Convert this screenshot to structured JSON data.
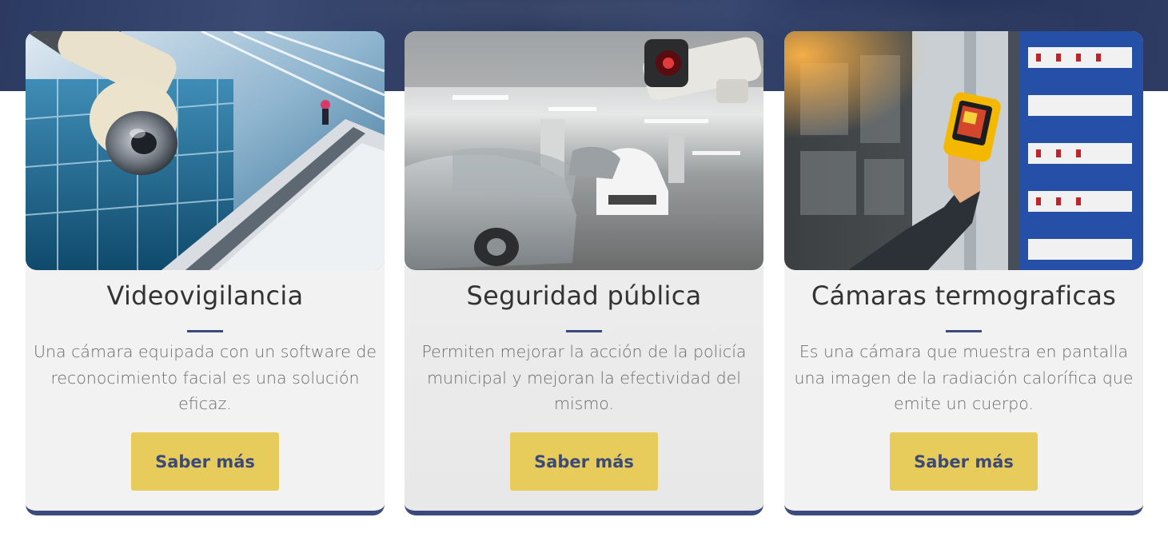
{
  "theme": {
    "accent": "#3a4a7c",
    "button_bg": "#e8cc5b",
    "button_text": "#3c4a78",
    "band": "#2b3a61"
  },
  "cards": [
    {
      "image": "dome-camera-escalator-photo",
      "title": "Videovigilancia",
      "description": "Una cámara equipada con un software de reconocimiento facial es una solución eficaz.",
      "button_label": "Saber más"
    },
    {
      "image": "parking-garage-camera-photo",
      "title": "Seguridad pública",
      "description": "Permiten mejorar la acción de la policía municipal y mejoran la efectividad del mismo.",
      "button_label": "Saber más"
    },
    {
      "image": "thermal-camera-electrical-panel-photo",
      "title": "Cámaras termograficas",
      "description": "Es una cámara que muestra en pantalla una imagen de la radiación calorífica que emite un cuerpo.",
      "button_label": "Saber más"
    }
  ]
}
